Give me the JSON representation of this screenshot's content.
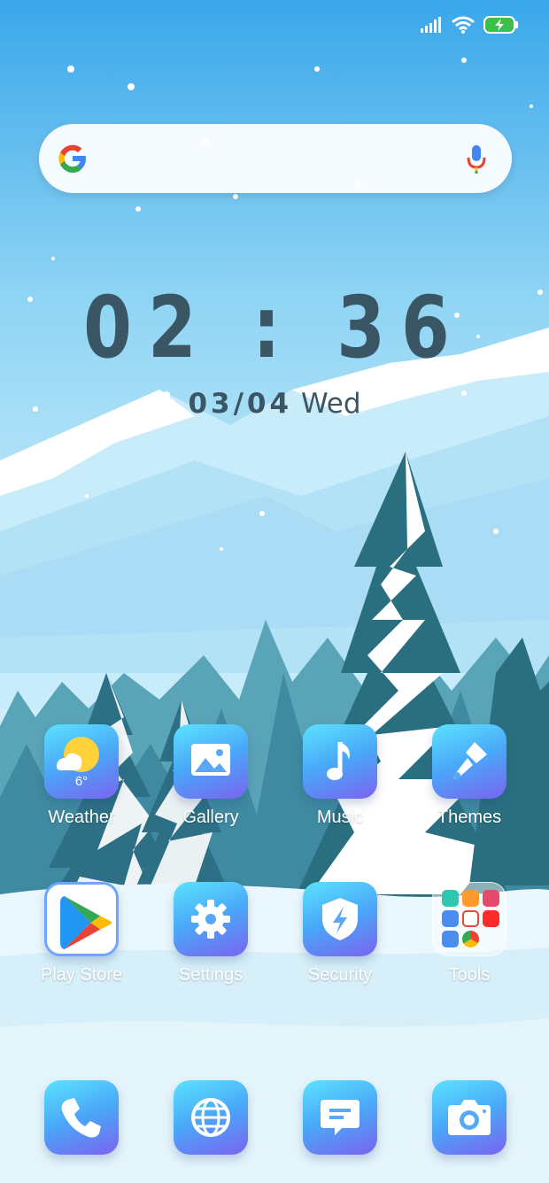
{
  "status_bar": {
    "signal_icon": "signal-icon",
    "wifi_icon": "wifi-icon",
    "battery_icon": "battery-charging-icon"
  },
  "search": {
    "placeholder": "",
    "logo_icon": "google-g-icon",
    "mic_icon": "mic-icon"
  },
  "clock": {
    "time": "02 : 36"
  },
  "date": {
    "numeric": "03/04",
    "weekday": "Wed"
  },
  "apps": {
    "weather": {
      "label": "Weather",
      "temp": "6°"
    },
    "gallery": {
      "label": "Gallery"
    },
    "music": {
      "label": "Music"
    },
    "themes": {
      "label": "Themes"
    },
    "play_store": {
      "label": "Play Store"
    },
    "settings": {
      "label": "Settings"
    },
    "security": {
      "label": "Security"
    },
    "tools": {
      "label": "Tools"
    }
  },
  "dock": {
    "phone_icon": "phone-icon",
    "browser_icon": "globe-icon",
    "messages_icon": "message-icon",
    "camera_icon": "camera-icon"
  },
  "colors": {
    "accent": "#4aa6f8",
    "clock_text": "#3a5564",
    "sky_top": "#3aa7ea",
    "battery_green": "#3cc04a"
  }
}
